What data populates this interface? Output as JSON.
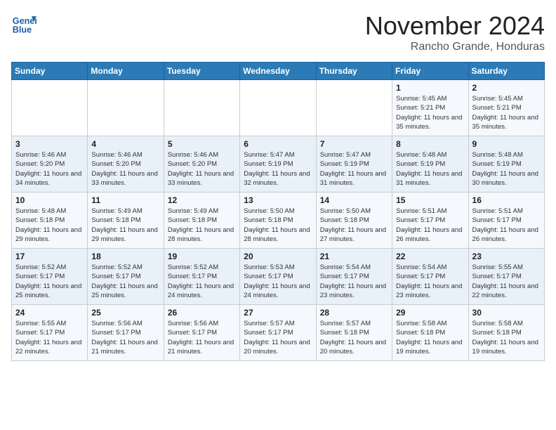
{
  "header": {
    "logo_line1": "General",
    "logo_line2": "Blue",
    "month": "November 2024",
    "location": "Rancho Grande, Honduras"
  },
  "weekdays": [
    "Sunday",
    "Monday",
    "Tuesday",
    "Wednesday",
    "Thursday",
    "Friday",
    "Saturday"
  ],
  "weeks": [
    [
      {
        "day": "",
        "info": ""
      },
      {
        "day": "",
        "info": ""
      },
      {
        "day": "",
        "info": ""
      },
      {
        "day": "",
        "info": ""
      },
      {
        "day": "",
        "info": ""
      },
      {
        "day": "1",
        "info": "Sunrise: 5:45 AM\nSunset: 5:21 PM\nDaylight: 11 hours and 35 minutes."
      },
      {
        "day": "2",
        "info": "Sunrise: 5:45 AM\nSunset: 5:21 PM\nDaylight: 11 hours and 35 minutes."
      }
    ],
    [
      {
        "day": "3",
        "info": "Sunrise: 5:46 AM\nSunset: 5:20 PM\nDaylight: 11 hours and 34 minutes."
      },
      {
        "day": "4",
        "info": "Sunrise: 5:46 AM\nSunset: 5:20 PM\nDaylight: 11 hours and 33 minutes."
      },
      {
        "day": "5",
        "info": "Sunrise: 5:46 AM\nSunset: 5:20 PM\nDaylight: 11 hours and 33 minutes."
      },
      {
        "day": "6",
        "info": "Sunrise: 5:47 AM\nSunset: 5:19 PM\nDaylight: 11 hours and 32 minutes."
      },
      {
        "day": "7",
        "info": "Sunrise: 5:47 AM\nSunset: 5:19 PM\nDaylight: 11 hours and 31 minutes."
      },
      {
        "day": "8",
        "info": "Sunrise: 5:48 AM\nSunset: 5:19 PM\nDaylight: 11 hours and 31 minutes."
      },
      {
        "day": "9",
        "info": "Sunrise: 5:48 AM\nSunset: 5:19 PM\nDaylight: 11 hours and 30 minutes."
      }
    ],
    [
      {
        "day": "10",
        "info": "Sunrise: 5:48 AM\nSunset: 5:18 PM\nDaylight: 11 hours and 29 minutes."
      },
      {
        "day": "11",
        "info": "Sunrise: 5:49 AM\nSunset: 5:18 PM\nDaylight: 11 hours and 29 minutes."
      },
      {
        "day": "12",
        "info": "Sunrise: 5:49 AM\nSunset: 5:18 PM\nDaylight: 11 hours and 28 minutes."
      },
      {
        "day": "13",
        "info": "Sunrise: 5:50 AM\nSunset: 5:18 PM\nDaylight: 11 hours and 28 minutes."
      },
      {
        "day": "14",
        "info": "Sunrise: 5:50 AM\nSunset: 5:18 PM\nDaylight: 11 hours and 27 minutes."
      },
      {
        "day": "15",
        "info": "Sunrise: 5:51 AM\nSunset: 5:17 PM\nDaylight: 11 hours and 26 minutes."
      },
      {
        "day": "16",
        "info": "Sunrise: 5:51 AM\nSunset: 5:17 PM\nDaylight: 11 hours and 26 minutes."
      }
    ],
    [
      {
        "day": "17",
        "info": "Sunrise: 5:52 AM\nSunset: 5:17 PM\nDaylight: 11 hours and 25 minutes."
      },
      {
        "day": "18",
        "info": "Sunrise: 5:52 AM\nSunset: 5:17 PM\nDaylight: 11 hours and 25 minutes."
      },
      {
        "day": "19",
        "info": "Sunrise: 5:52 AM\nSunset: 5:17 PM\nDaylight: 11 hours and 24 minutes."
      },
      {
        "day": "20",
        "info": "Sunrise: 5:53 AM\nSunset: 5:17 PM\nDaylight: 11 hours and 24 minutes."
      },
      {
        "day": "21",
        "info": "Sunrise: 5:54 AM\nSunset: 5:17 PM\nDaylight: 11 hours and 23 minutes."
      },
      {
        "day": "22",
        "info": "Sunrise: 5:54 AM\nSunset: 5:17 PM\nDaylight: 11 hours and 23 minutes."
      },
      {
        "day": "23",
        "info": "Sunrise: 5:55 AM\nSunset: 5:17 PM\nDaylight: 11 hours and 22 minutes."
      }
    ],
    [
      {
        "day": "24",
        "info": "Sunrise: 5:55 AM\nSunset: 5:17 PM\nDaylight: 11 hours and 22 minutes."
      },
      {
        "day": "25",
        "info": "Sunrise: 5:56 AM\nSunset: 5:17 PM\nDaylight: 11 hours and 21 minutes."
      },
      {
        "day": "26",
        "info": "Sunrise: 5:56 AM\nSunset: 5:17 PM\nDaylight: 11 hours and 21 minutes."
      },
      {
        "day": "27",
        "info": "Sunrise: 5:57 AM\nSunset: 5:17 PM\nDaylight: 11 hours and 20 minutes."
      },
      {
        "day": "28",
        "info": "Sunrise: 5:57 AM\nSunset: 5:18 PM\nDaylight: 11 hours and 20 minutes."
      },
      {
        "day": "29",
        "info": "Sunrise: 5:58 AM\nSunset: 5:18 PM\nDaylight: 11 hours and 19 minutes."
      },
      {
        "day": "30",
        "info": "Sunrise: 5:58 AM\nSunset: 5:18 PM\nDaylight: 11 hours and 19 minutes."
      }
    ]
  ]
}
